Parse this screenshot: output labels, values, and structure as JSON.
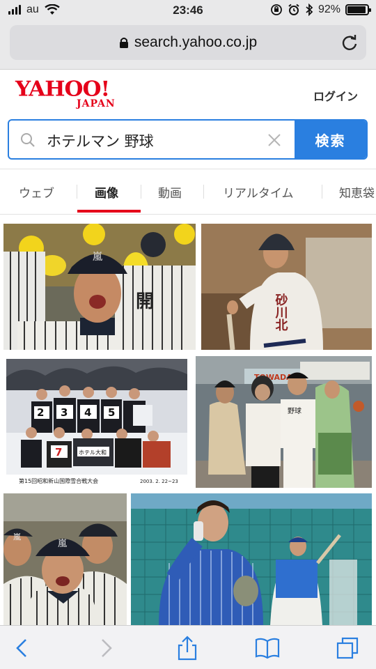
{
  "status": {
    "carrier": "au",
    "time": "23:46",
    "battery": "92%",
    "battery_level": 0.92
  },
  "url_bar": {
    "domain": "search.yahoo.co.jp"
  },
  "header": {
    "logo_main": "YAHOO!",
    "logo_sub": "JAPAN",
    "login_label": "ログイン"
  },
  "search": {
    "query": "ホテルマン 野球",
    "button_label": "検索"
  },
  "tabs": [
    {
      "label": "ウェブ",
      "active": false
    },
    {
      "label": "画像",
      "active": true
    },
    {
      "label": "動画",
      "active": false
    },
    {
      "label": "リアルタイム",
      "active": false
    },
    {
      "label": "知恵袋",
      "active": false
    }
  ],
  "images": [
    {
      "name": "cheering-player",
      "caption": "開"
    },
    {
      "name": "batter-portrait",
      "caption": "砂川北"
    },
    {
      "name": "team-snow-photo",
      "caption": "第15回昭和新山国際雪合戦大会",
      "date": "2003. 2. 22~23",
      "bibs": [
        "3",
        "4",
        "5",
        "7",
        "2"
      ],
      "banner": "ホテル大和"
    },
    {
      "name": "station-group",
      "caption": "野球",
      "sign": "TOWADA"
    },
    {
      "name": "players-close",
      "caption": "嵐"
    },
    {
      "name": "man-phone-practice",
      "caption": ""
    }
  ],
  "toolbar": {
    "back": "back-icon",
    "forward": "forward-icon",
    "share": "share-icon",
    "bookmarks": "bookmarks-icon",
    "tabs": "tabs-icon"
  }
}
